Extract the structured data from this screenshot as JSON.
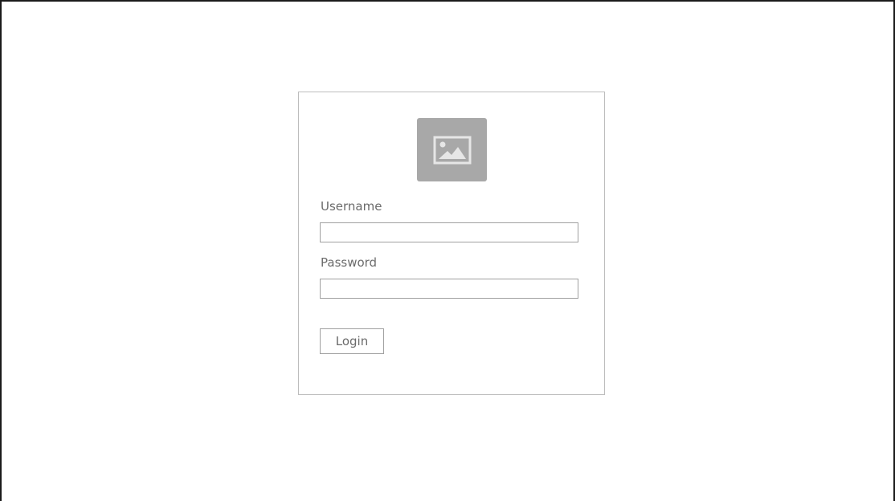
{
  "login_form": {
    "logo": {
      "icon": "image-icon",
      "background_color": "#a8a8a8",
      "icon_color": "#e6e6e6"
    },
    "username": {
      "label": "Username",
      "value": "",
      "placeholder": ""
    },
    "password": {
      "label": "Password",
      "value": "",
      "placeholder": ""
    },
    "submit_label": "Login"
  }
}
